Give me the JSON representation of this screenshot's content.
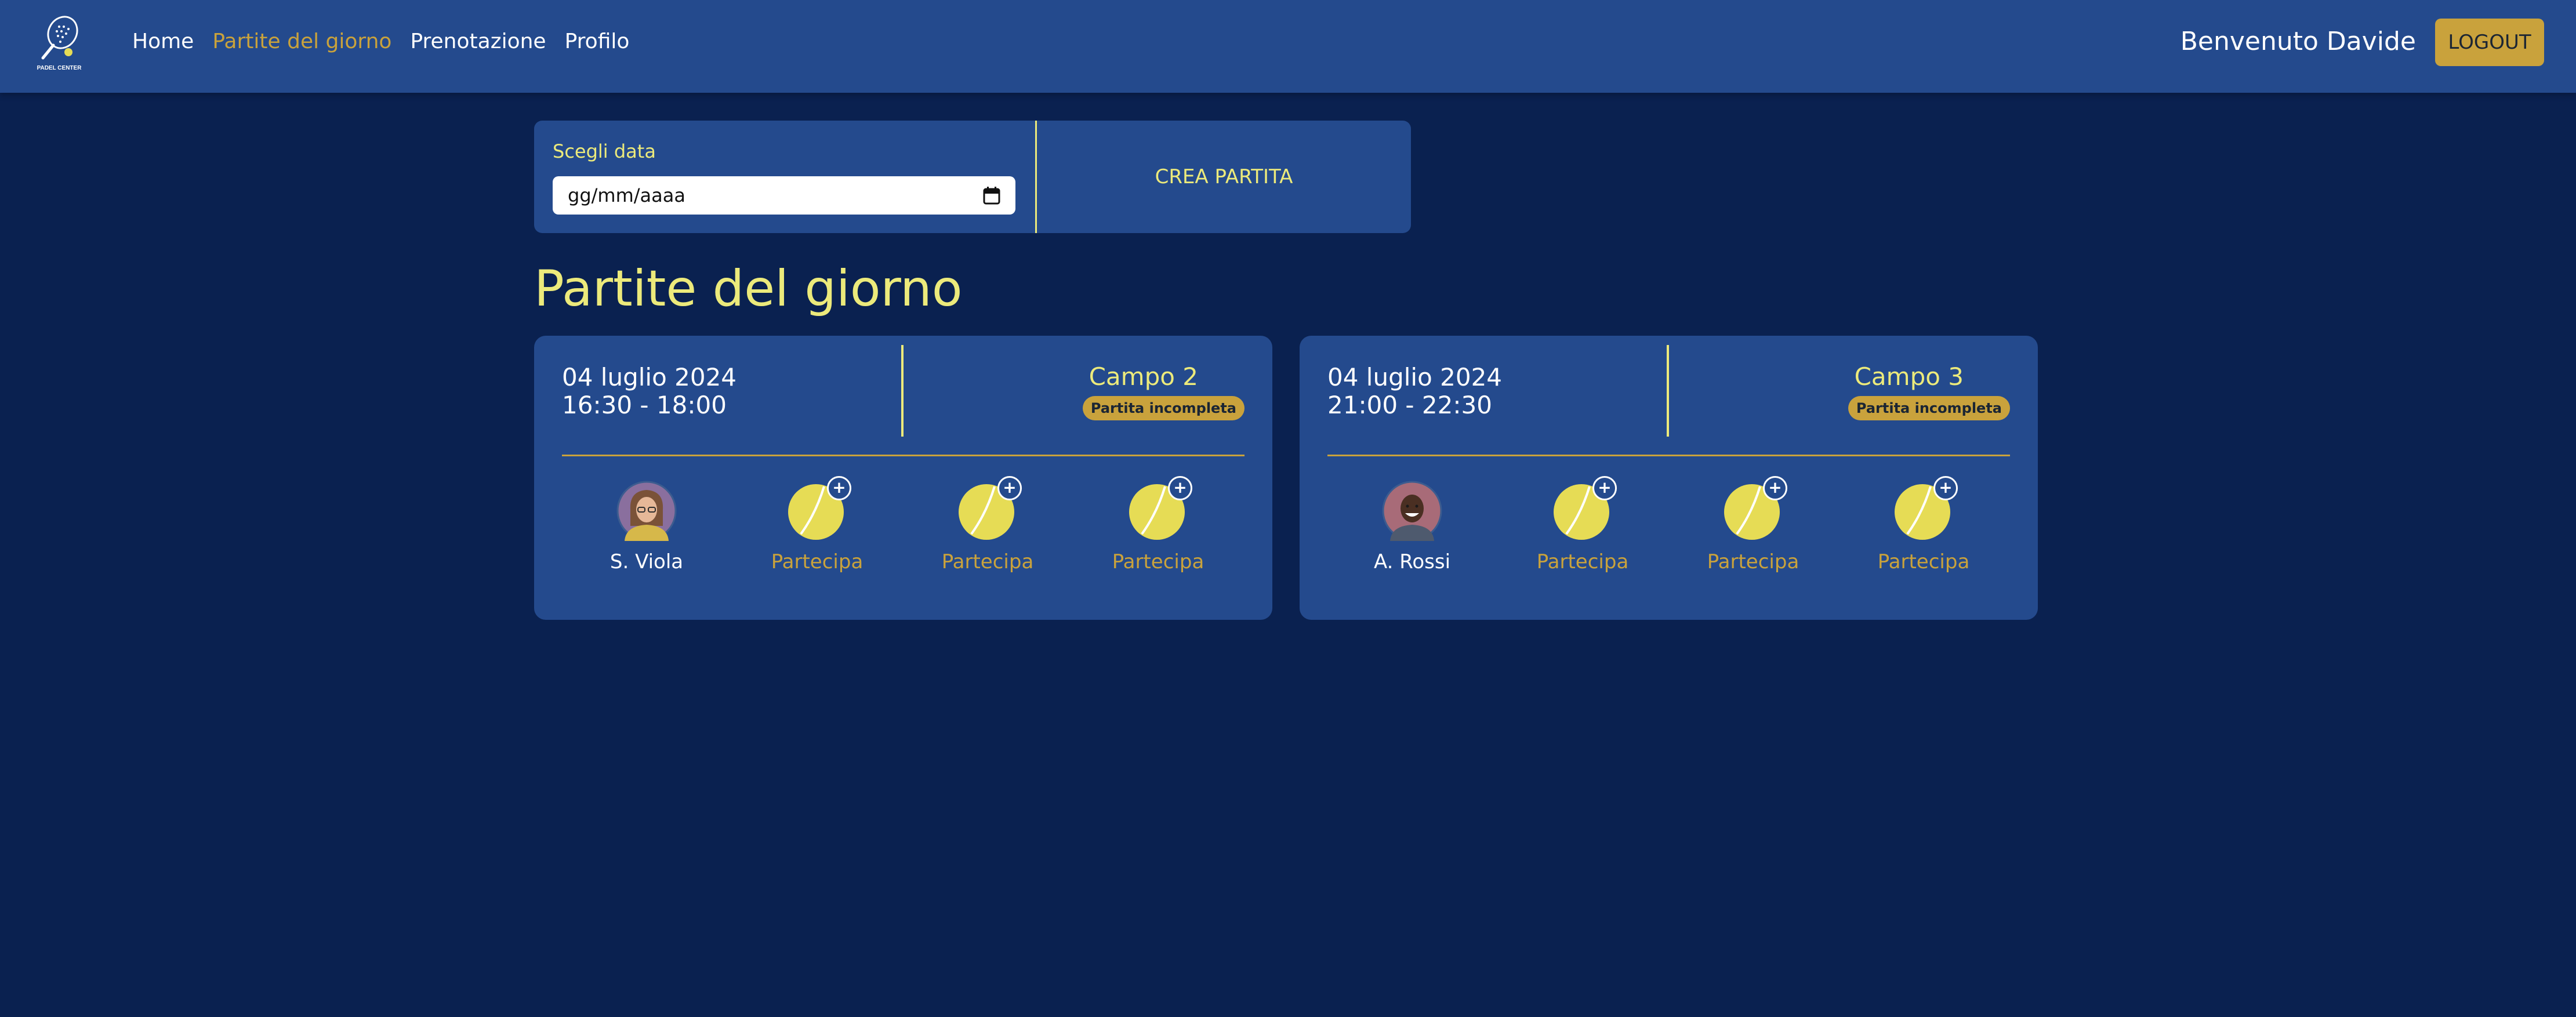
{
  "brand": {
    "logo_text": "PADEL CENTER"
  },
  "nav": {
    "links": [
      {
        "label": "Home",
        "active": false
      },
      {
        "label": "Partite del giorno",
        "active": true
      },
      {
        "label": "Prenotazione",
        "active": false
      },
      {
        "label": "Profilo",
        "active": false
      }
    ],
    "welcome": "Benvenuto Davide",
    "logout_label": "LOGOUT"
  },
  "filter": {
    "date_label": "Scegli data",
    "date_placeholder": "gg/mm/aaaa",
    "create_label": "CREA PARTITA"
  },
  "page_title": "Partite del giorno",
  "matches": [
    {
      "date": "04 luglio 2024",
      "time": "16:30 - 18:00",
      "field": "Campo 2",
      "status": "Partita incompleta",
      "slots": [
        {
          "type": "player",
          "name": "S. Viola",
          "icon": "avatar"
        },
        {
          "type": "open",
          "label": "Partecipa",
          "icon": "tennis-ball-icon"
        },
        {
          "type": "open",
          "label": "Partecipa",
          "icon": "tennis-ball-icon"
        },
        {
          "type": "open",
          "label": "Partecipa",
          "icon": "tennis-ball-icon"
        }
      ]
    },
    {
      "date": "04 luglio 2024",
      "time": "21:00 - 22:30",
      "field": "Campo 3",
      "status": "Partita incompleta",
      "slots": [
        {
          "type": "player",
          "name": "A. Rossi",
          "icon": "avatar"
        },
        {
          "type": "open",
          "label": "Partecipa",
          "icon": "tennis-ball-icon"
        },
        {
          "type": "open",
          "label": "Partecipa",
          "icon": "tennis-ball-icon"
        },
        {
          "type": "open",
          "label": "Partecipa",
          "icon": "tennis-ball-icon"
        }
      ]
    }
  ],
  "colors": {
    "page_bg": "#0a2150",
    "panel_bg": "#244a8d",
    "accent_yellow": "#ecea7b",
    "accent_gold": "#c9a23c",
    "ball": "#e6dc55"
  }
}
